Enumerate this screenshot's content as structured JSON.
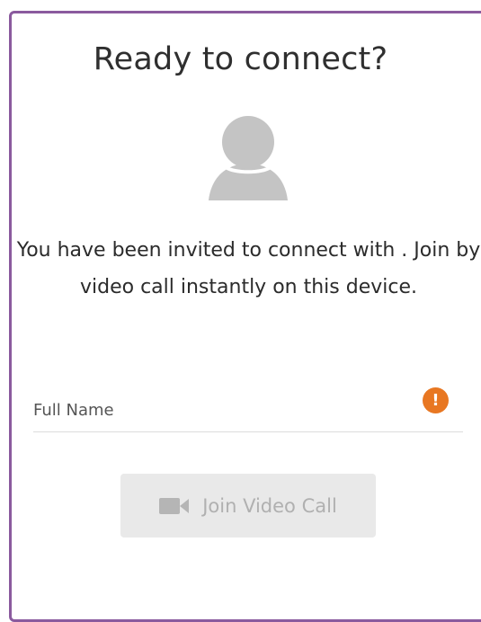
{
  "title": "Ready to connect?",
  "message": "You have been invited to connect with . Join by video call instantly on this device.",
  "form": {
    "name_placeholder": "Full Name",
    "name_value": "",
    "warning_glyph": "!"
  },
  "join_button": {
    "label": "Join Video Call",
    "icon": "video-camera-icon",
    "enabled": false
  },
  "avatar": {
    "icon": "user-avatar-icon"
  },
  "colors": {
    "frame_border": "#8a5a9e",
    "warning": "#e87722",
    "button_bg_disabled": "#e9e9e9",
    "button_text_disabled": "#b0b0b0",
    "avatar": "#c4c4c4"
  }
}
